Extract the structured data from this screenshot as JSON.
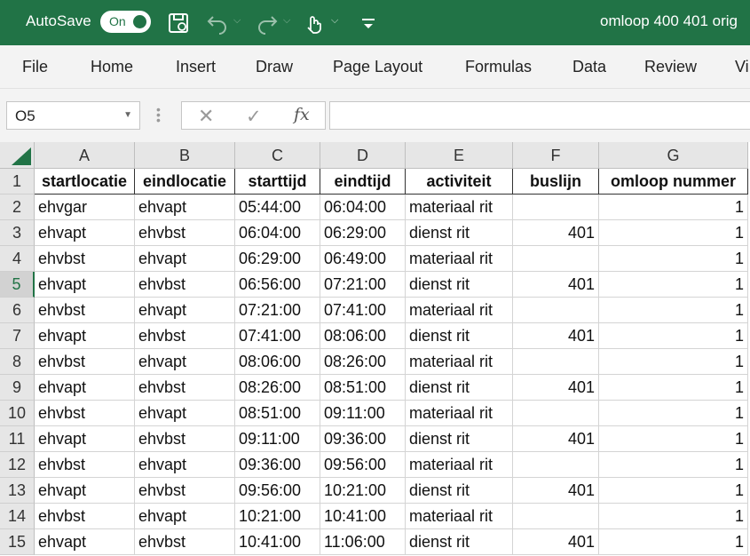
{
  "titlebar": {
    "autosave_label": "AutoSave",
    "toggle_label": "On",
    "window_title": "omloop 400 401 orig"
  },
  "colors": {
    "excel_green": "#217346",
    "header_gray": "#e6e6e6",
    "ribbon_bg": "#f3f3f3"
  },
  "menu": [
    "File",
    "Home",
    "Insert",
    "Draw",
    "Page Layout",
    "Formulas",
    "Data",
    "Review",
    "Vi"
  ],
  "formula_bar": {
    "name_box": "O5",
    "formula": ""
  },
  "columns": [
    "A",
    "B",
    "C",
    "D",
    "E",
    "F",
    "G"
  ],
  "header_row": [
    "startlocatie",
    "eindlocatie",
    "starttijd",
    "eindtijd",
    "activiteit",
    "buslijn",
    "omloop nummer"
  ],
  "rows": [
    [
      "ehvgar",
      "ehvapt",
      "05:44:00",
      "06:04:00",
      "materiaal rit",
      "",
      "1"
    ],
    [
      "ehvapt",
      "ehvbst",
      "06:04:00",
      "06:29:00",
      "dienst rit",
      "401",
      "1"
    ],
    [
      "ehvbst",
      "ehvapt",
      "06:29:00",
      "06:49:00",
      "materiaal rit",
      "",
      "1"
    ],
    [
      "ehvapt",
      "ehvbst",
      "06:56:00",
      "07:21:00",
      "dienst rit",
      "401",
      "1"
    ],
    [
      "ehvbst",
      "ehvapt",
      "07:21:00",
      "07:41:00",
      "materiaal rit",
      "",
      "1"
    ],
    [
      "ehvapt",
      "ehvbst",
      "07:41:00",
      "08:06:00",
      "dienst rit",
      "401",
      "1"
    ],
    [
      "ehvbst",
      "ehvapt",
      "08:06:00",
      "08:26:00",
      "materiaal rit",
      "",
      "1"
    ],
    [
      "ehvapt",
      "ehvbst",
      "08:26:00",
      "08:51:00",
      "dienst rit",
      "401",
      "1"
    ],
    [
      "ehvbst",
      "ehvapt",
      "08:51:00",
      "09:11:00",
      "materiaal rit",
      "",
      "1"
    ],
    [
      "ehvapt",
      "ehvbst",
      "09:11:00",
      "09:36:00",
      "dienst rit",
      "401",
      "1"
    ],
    [
      "ehvbst",
      "ehvapt",
      "09:36:00",
      "09:56:00",
      "materiaal rit",
      "",
      "1"
    ],
    [
      "ehvapt",
      "ehvbst",
      "09:56:00",
      "10:21:00",
      "dienst rit",
      "401",
      "1"
    ],
    [
      "ehvbst",
      "ehvapt",
      "10:21:00",
      "10:41:00",
      "materiaal rit",
      "",
      "1"
    ],
    [
      "ehvapt",
      "ehvbst",
      "10:41:00",
      "11:06:00",
      "dienst rit",
      "401",
      "1"
    ]
  ],
  "row_numbers": [
    "1",
    "2",
    "3",
    "4",
    "5",
    "6",
    "7",
    "8",
    "9",
    "10",
    "11",
    "12",
    "13",
    "14",
    "15"
  ],
  "icons": [
    "save-icon",
    "undo-icon",
    "redo-icon",
    "touch-mode-icon",
    "customize-toolbar-icon",
    "cancel-icon",
    "enter-icon",
    "function-icon",
    "select-all-icon"
  ]
}
